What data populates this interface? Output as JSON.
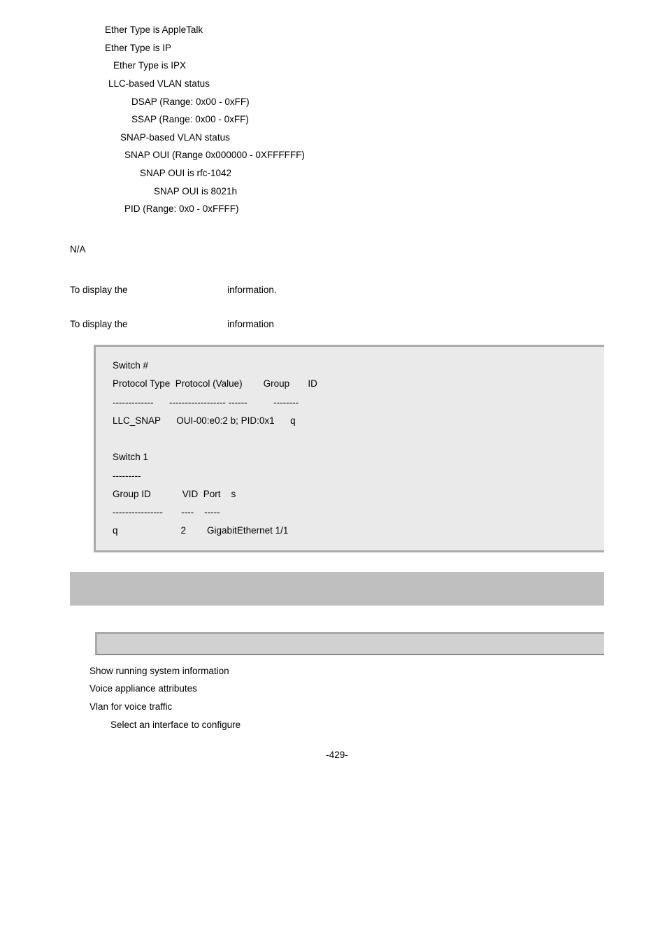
{
  "lines": {
    "l1": "Ether Type is AppleTalk",
    "l2": "Ether Type is IP",
    "l3": "Ether Type is IPX",
    "l4": "LLC-based VLAN status",
    "l5": "DSAP (Range: 0x00 - 0xFF)",
    "l6": "SSAP (Range: 0x00 - 0xFF)",
    "l7": "SNAP-based VLAN status",
    "l8": "SNAP OUI (Range 0x000000 - 0XFFFFFF)",
    "l9": "SNAP OUI is rfc-1042",
    "l10": "SNAP OUI is 8021h",
    "l11": "PID (Range: 0x0 - 0xFFFF)"
  },
  "na": "N/A",
  "disp1": {
    "prefix": "To display the",
    "suffix": "information."
  },
  "disp2": {
    "prefix": "To display the",
    "suffix": "information"
  },
  "output": {
    "r1": "Switch #",
    "r2": "Protocol Type  Protocol (Value)        Group       ID",
    "r3": "-------------      ------------------ ------          --------",
    "r4": "LLC_SNAP      OUI-00:e0:2 b; PID:0x1      q",
    "r5": "Switch 1",
    "r6": "---------",
    "r7": "Group ID            VID  Port    s",
    "r8": "----------------       ----    -----",
    "r9": "q                        2        GigabitEthernet 1/1"
  },
  "cmds": {
    "c1": "Show running system information",
    "c2": "Voice appliance attributes",
    "c3": "Vlan for voice traffic",
    "c4": "Select an interface to configure"
  },
  "page": "-429-"
}
